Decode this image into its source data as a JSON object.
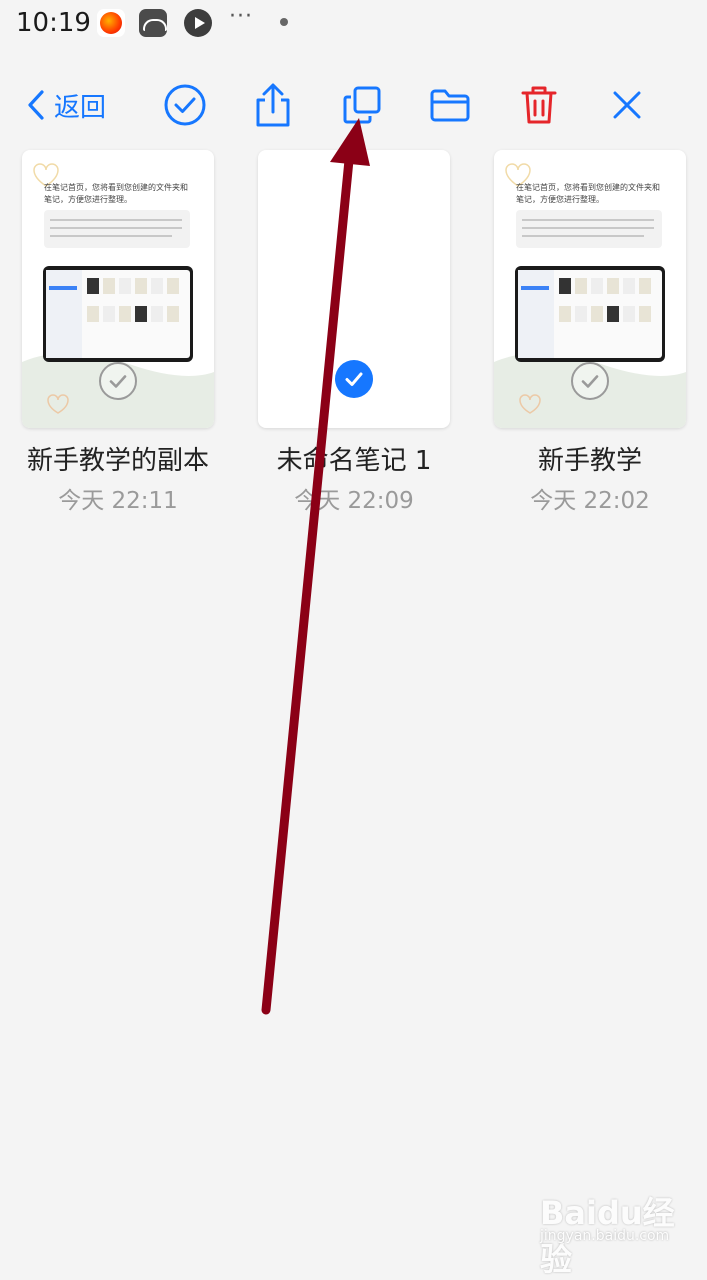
{
  "status_bar": {
    "time": "10:19",
    "more": "···",
    "icons": [
      "app-icon-orange",
      "app-icon-game",
      "app-icon-play"
    ]
  },
  "toolbar": {
    "back_label": "返回",
    "accent_color": "#1677ff",
    "delete_color": "#e5252a",
    "actions": [
      "select-all-icon",
      "share-icon",
      "copy-icon",
      "folder-icon",
      "trash-icon",
      "close-icon"
    ]
  },
  "notes": [
    {
      "title": "新手教学的副本",
      "date": "今天 22:11",
      "selected": false,
      "preview_text": [
        "在笔记首页，您将看到您创建的文件夹和",
        "笔记，方便您进行整理。"
      ]
    },
    {
      "title": "未命名笔记 1",
      "date": "今天 22:09",
      "selected": true
    },
    {
      "title": "新手教学",
      "date": "今天 22:02",
      "selected": false,
      "preview_text": [
        "在笔记首页，您将看到您创建的文件夹和",
        "笔记，方便您进行整理。"
      ]
    }
  ],
  "annotation": {
    "color": "#8b0016"
  },
  "watermark": {
    "brand": "Baidu经验",
    "url": "jingyan.baidu.com"
  }
}
